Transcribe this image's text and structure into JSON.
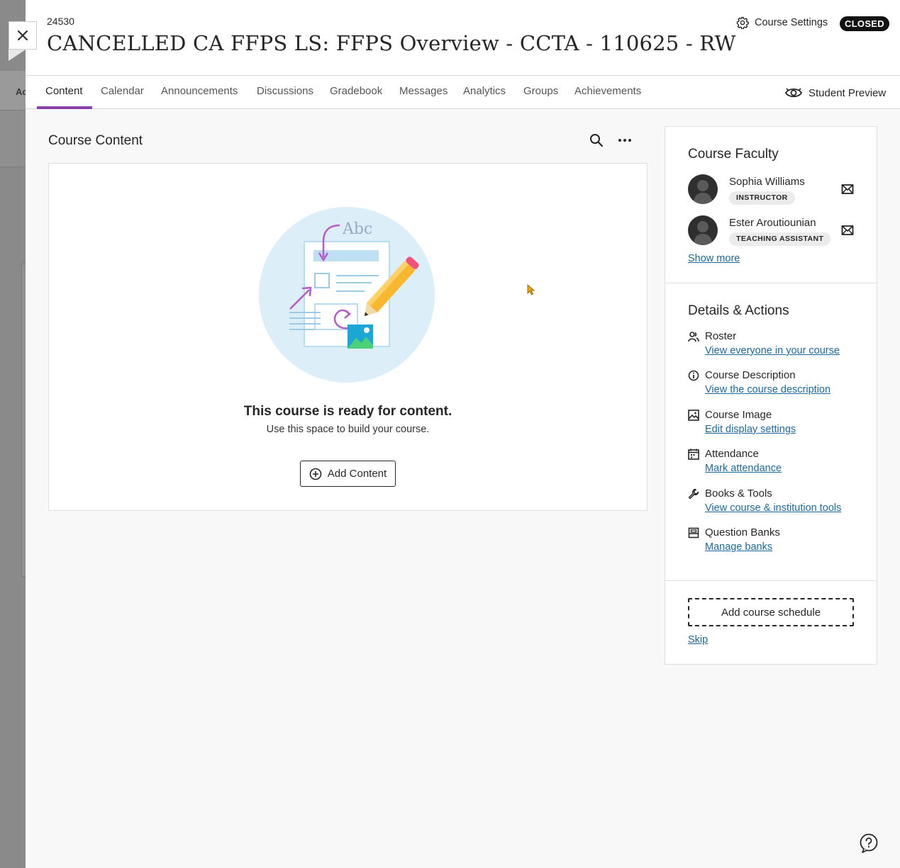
{
  "course": {
    "id": "24530",
    "title": "CANCELLED CA FFPS LS: FFPS Overview - CCTA - 110625 - RW",
    "settings_label": "Course Settings",
    "status_badge": "CLOSED"
  },
  "background": {
    "partial_label": "Ac"
  },
  "tabs": [
    {
      "label": "Content",
      "active": true
    },
    {
      "label": "Calendar"
    },
    {
      "label": "Announcements"
    },
    {
      "label": "Discussions"
    },
    {
      "label": "Gradebook"
    },
    {
      "label": "Messages"
    },
    {
      "label": "Analytics"
    },
    {
      "label": "Groups"
    },
    {
      "label": "Achievements"
    }
  ],
  "student_preview_label": "Student Preview",
  "course_content": {
    "title": "Course Content",
    "empty_title": "This course is ready for content.",
    "empty_subtitle": "Use this space to build your course.",
    "add_content_label": "Add Content",
    "illustration_text": "Abc"
  },
  "faculty": {
    "title": "Course Faculty",
    "members": [
      {
        "name": "Sophia Williams",
        "role": "INSTRUCTOR"
      },
      {
        "name": "Ester Aroutiounian",
        "role": "TEACHING ASSISTANT"
      }
    ],
    "show_more": "Show more"
  },
  "details": {
    "title": "Details & Actions",
    "items": [
      {
        "label": "Roster",
        "link": "View everyone in your course",
        "icon": "roster-icon"
      },
      {
        "label": "Course Description",
        "link": "View the course description",
        "icon": "info-icon"
      },
      {
        "label": "Course Image",
        "link": "Edit display settings",
        "icon": "image-icon"
      },
      {
        "label": "Attendance",
        "link": "Mark attendance",
        "icon": "attendance-icon"
      },
      {
        "label": "Books & Tools",
        "link": "View course & institution tools",
        "icon": "wrench-icon"
      },
      {
        "label": "Question Banks",
        "link": "Manage banks",
        "icon": "question-bank-icon"
      }
    ]
  },
  "schedule": {
    "button_label": "Add course schedule",
    "skip_label": "Skip"
  },
  "colors": {
    "accent": "#8b3fa9",
    "link": "#1a6aa0",
    "badge_bg": "#111111"
  }
}
